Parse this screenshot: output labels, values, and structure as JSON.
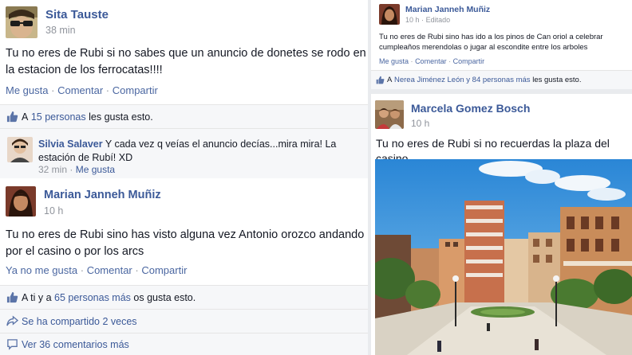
{
  "left": {
    "post1": {
      "author": "Sita Tauste",
      "time": "38 min",
      "text": "Tu no eres de Rubi si no sabes que un anuncio de donetes se rodo en la estacion de los ferrocatas!!!!",
      "actions": {
        "like": "Me gusta",
        "comment": "Comentar",
        "share": "Compartir",
        "sep": "·"
      },
      "likes": {
        "prefix": "A",
        "link": "15 personas",
        "suffix": "les gusta esto."
      },
      "comment": {
        "author": "Silvia Salaver",
        "text": "Y cada vez q veías el anuncio decías...mira mira! La estación de Rubí! XD",
        "time": "32 min",
        "like": "Me gusta"
      }
    },
    "post2": {
      "author": "Marian Janneh Muñiz",
      "time": "10 h",
      "text": "Tu no eres de Rubi sino has visto alguna vez Antonio orozco andando por el casino o por los arcs",
      "actions": {
        "like": "Ya no me gusta",
        "comment": "Comentar",
        "share": "Compartir"
      },
      "likes": {
        "prefix": "A ti y a",
        "link": "65 personas más",
        "suffix": "os gusta esto."
      },
      "shared": "Se ha compartido 2 veces",
      "more_comments": "Ver 36 comentarios más"
    }
  },
  "right": {
    "post1": {
      "author": "Marian Janneh Muñiz",
      "time": "10 h",
      "edited": "Editado",
      "text": "Tu no eres de Rubi sino has ido a los pinos de Can oriol a celebrar cumpleaños merendolas o jugar al escondite entre los arboles",
      "actions": {
        "like": "Me gusta",
        "comment": "Comentar",
        "share": "Compartir"
      },
      "likes": {
        "prefix": "A",
        "link": "Nerea Jiménez León y 84 personas más",
        "suffix": "les gusta esto."
      }
    },
    "post2": {
      "author": "Marcela Gomez Bosch",
      "time": "10 h",
      "text": "Tu no eres de Rubi si no recuerdas la plaza del casino"
    }
  },
  "icons": {
    "like": "thumbs-up-icon",
    "share": "share-arrow-icon",
    "comments": "comment-bubble-icon"
  },
  "colors": {
    "link": "#3b5998",
    "meta": "#90949c",
    "bar_bg": "#f6f7f9",
    "text": "#141823"
  }
}
